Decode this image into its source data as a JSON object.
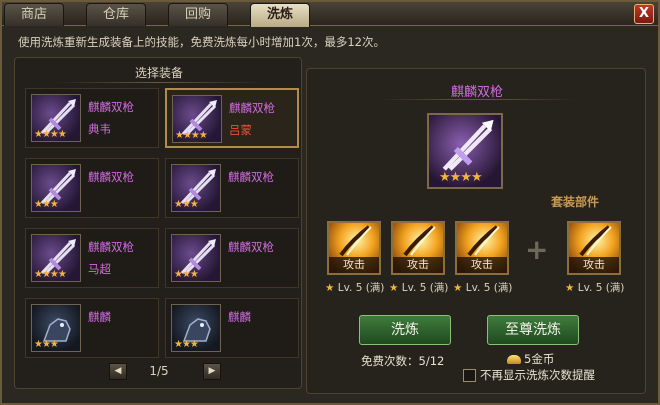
{
  "tabs": [
    {
      "label": "商店",
      "active": false
    },
    {
      "label": "仓库",
      "active": false
    },
    {
      "label": "回购",
      "active": false
    },
    {
      "label": "洗炼",
      "active": true
    }
  ],
  "close_label": "X",
  "hint": "使用洗炼重新生成装备上的技能，免费洗炼每小时增加1次，最多12次。",
  "left_panel": {
    "title": "选择装备",
    "items": [
      {
        "name": "麒麟双枪",
        "owner": "典韦",
        "stars": "★★★★",
        "selected": false
      },
      {
        "name": "麒麟双枪",
        "owner": "吕蒙",
        "stars": "★★★★",
        "selected": true
      },
      {
        "name": "麒麟双枪",
        "owner": "",
        "stars": "★★★",
        "selected": false
      },
      {
        "name": "麒麟双枪",
        "owner": "",
        "stars": "★★★",
        "selected": false
      },
      {
        "name": "麒麟双枪",
        "owner": "马超",
        "stars": "★★★★",
        "selected": false
      },
      {
        "name": "麒麟双枪",
        "owner": "",
        "stars": "★★★",
        "selected": false
      },
      {
        "name": "麒麟",
        "owner": "",
        "stars": "★★★",
        "selected": false
      },
      {
        "name": "麒麟",
        "owner": "",
        "stars": "★★★",
        "selected": false
      }
    ],
    "pager": {
      "prev": "◀",
      "next": "▶",
      "page_text": "1/5"
    }
  },
  "right_panel": {
    "title": "麒麟双枪",
    "stars": "★★★★",
    "set_label": "套装部件",
    "parts": [
      {
        "label": "攻击",
        "level": "Lv. 5 (满)",
        "star": "★"
      },
      {
        "label": "攻击",
        "level": "Lv. 5 (满)",
        "star": "★"
      },
      {
        "label": "攻击",
        "level": "Lv. 5 (满)",
        "star": "★"
      },
      {
        "label": "攻击",
        "level": "Lv. 5 (满)",
        "star": "★"
      }
    ],
    "plus": "+",
    "refine_button": "洗炼",
    "supreme_button": "至尊洗炼",
    "free_text": "免费次数：5/12",
    "gold_text": "5金币",
    "no_remind_text": "不再显示洗炼次数提醒"
  },
  "colors": {
    "purple_name": "#d06be0",
    "red_owner": "#e0563a",
    "star": "#f2b43a",
    "button_green": "#3f7c3c"
  },
  "icons": {
    "weapon": "twin-spear-icon",
    "part": "slash-icon",
    "gold": "gold-ingot-icon"
  }
}
